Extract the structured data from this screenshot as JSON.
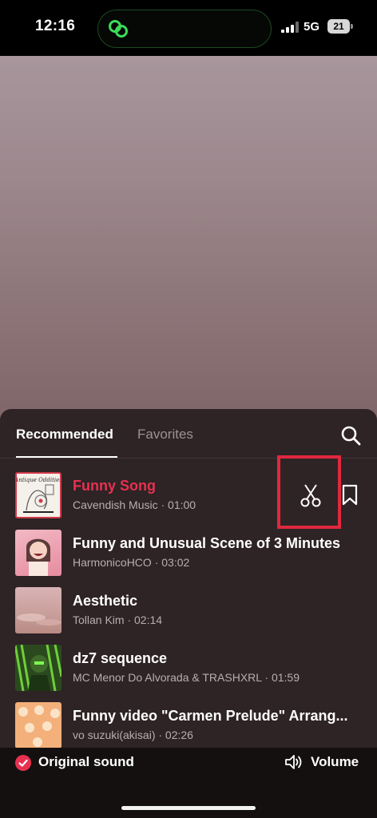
{
  "status_bar": {
    "time": "12:16",
    "network": "5G",
    "battery": "21",
    "island_icon": "link-rings-icon"
  },
  "tabs": [
    {
      "label": "Recommended",
      "active": true
    },
    {
      "label": "Favorites",
      "active": false
    }
  ],
  "tracks": [
    {
      "title": "Funny Song",
      "meta": "Cavendish Music · 01:00",
      "selected": true
    },
    {
      "title": "Funny and Unusual Scene of 3 Minutes",
      "meta": "HarmonicoHCO · 03:02",
      "selected": false
    },
    {
      "title": "Aesthetic",
      "meta": "Tollan Kim · 02:14",
      "selected": false
    },
    {
      "title": "dz7 sequence",
      "meta": "MC Menor Do Alvorada & TRASHXRL · 01:59",
      "selected": false
    },
    {
      "title": "Funny video \"Carmen Prelude\" Arrang...",
      "meta": "vo suzuki(akisai) · 02:26",
      "selected": false
    }
  ],
  "thumb1_text": "Antique Oddities",
  "bottom": {
    "original_sound": "Original sound",
    "volume": "Volume"
  },
  "colors": {
    "accent_red": "#e8314f",
    "highlight_box": "#e0283f",
    "sheet_bg": "#2e2325"
  }
}
